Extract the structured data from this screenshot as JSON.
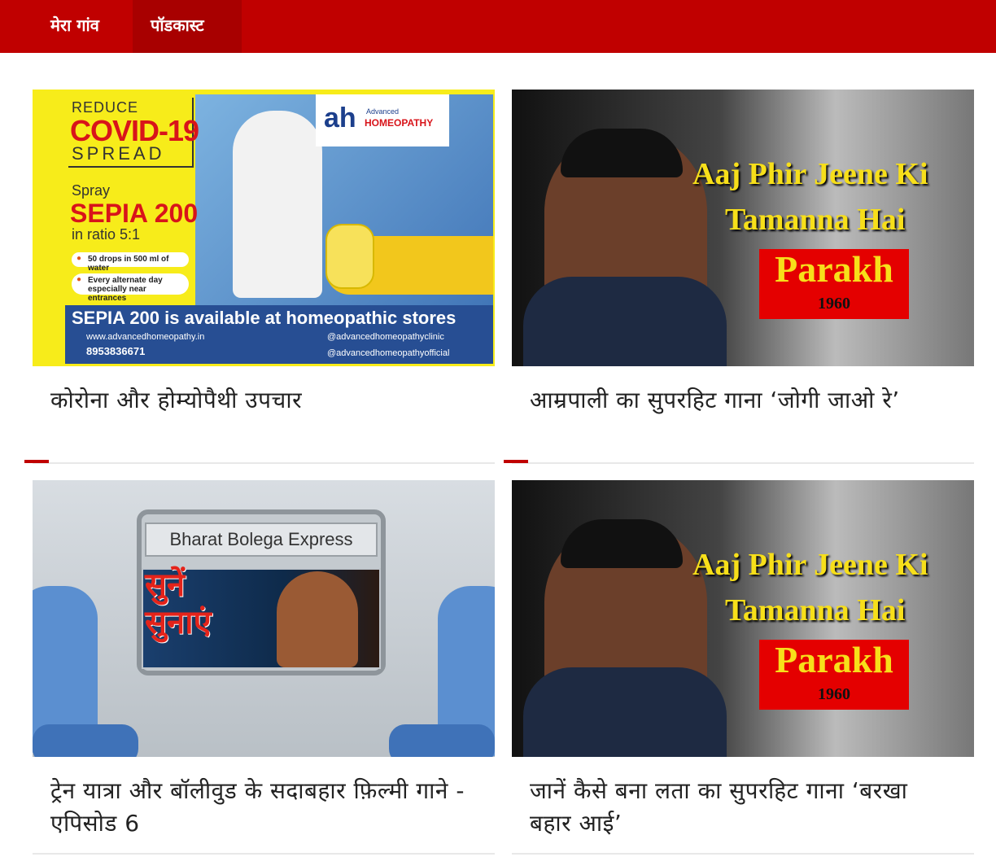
{
  "nav": {
    "items": [
      {
        "label": "मेरा गांव"
      },
      {
        "label": "पॉडकास्ट"
      }
    ]
  },
  "cards": [
    {
      "title": "कोरोना और होम्योपैथी उपचार",
      "thumb": {
        "reduce": "REDUCE",
        "covid": "COVID-19",
        "spread": "SPREAD",
        "spray": "Spray",
        "sepia": "SEPIA 200",
        "ratio": "in ratio 5:1",
        "pill1": "50 drops in 500 ml of water",
        "pill2": "Every alternate day especially near entrances",
        "available": "SEPIA 200 is available at homeopathic stores",
        "website": "www.advancedhomeopathy.in",
        "phone": "8953836671",
        "instagram": "@advancedhomeopathyclinic",
        "facebook": "@advancedhomeopathyofficial",
        "logo_mark": "ah",
        "logo_small": "Advanced",
        "logo_name": "HOMEOPATHY"
      }
    },
    {
      "title": "आम्रपाली का सुपरहिट गाना ‘जोगी जाओ रे’",
      "thumb": {
        "line1": "Aaj Phir Jeene Ki",
        "line2": "Tamanna Hai",
        "film": "Parakh",
        "year": "1960"
      }
    },
    {
      "title": "ट्रेन यात्रा और बॉलीवुड के सदाबहार फ़िल्मी गाने - एपिसोड 6",
      "thumb": {
        "label": "Bharat Bolega Express",
        "line1": "सुनें",
        "line2": "सुनाएं"
      }
    },
    {
      "title": "जानें कैसे बना लता का सुपरहिट गाना ‘बरखा बहार आई’",
      "thumb": {
        "line1": "Aaj Phir Jeene Ki",
        "line2": "Tamanna Hai",
        "film": "Parakh",
        "year": "1960"
      }
    }
  ],
  "colors": {
    "brand_red": "#c00000",
    "nav_active": "#a80000"
  }
}
